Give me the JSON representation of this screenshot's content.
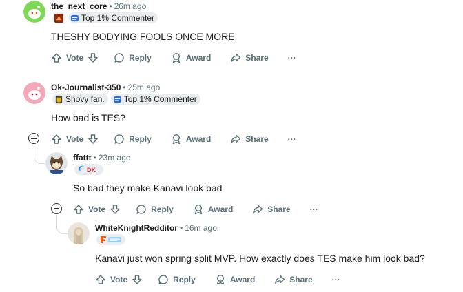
{
  "comments": [
    {
      "author": "the_next_core",
      "time": "26m ago",
      "flairs": [
        {
          "label": "",
          "icon": "team-logo-icon"
        },
        {
          "label": "Top 1% Commenter",
          "icon": "commenter-badge-icon"
        }
      ],
      "body": "THESHY BODYING FOOLS ONCE MORE",
      "actions": {
        "vote": "Vote",
        "reply": "Reply",
        "award": "Award",
        "share": "Share",
        "more": "···"
      }
    },
    {
      "author": "Ok-Journalist-350",
      "time": "25m ago",
      "flairs": [
        {
          "label": "Shovy fan.",
          "icon": "shovy-flair-icon"
        },
        {
          "label": "Top 1% Commenter",
          "icon": "commenter-badge-icon"
        }
      ],
      "body": "How bad is TES?",
      "actions": {
        "vote": "Vote",
        "reply": "Reply",
        "award": "Award",
        "share": "Share",
        "more": "···"
      }
    },
    {
      "author": "ffattt",
      "time": "23m ago",
      "flairs": [
        {
          "label": "",
          "icon": "team-logo-icon"
        }
      ],
      "body": "So bad they make Kanavi look bad",
      "actions": {
        "vote": "Vote",
        "reply": "Reply",
        "award": "Award",
        "share": "Share",
        "more": "···"
      }
    },
    {
      "author": "WhiteKnightRedditor",
      "time": "16m ago",
      "flairs": [
        {
          "label": "",
          "icon": "fnatic-logo-icon"
        }
      ],
      "body": "Kanavi just won spring split MVP. How exactly does TES make him look bad?",
      "actions": {
        "vote": "Vote",
        "reply": "Reply",
        "award": "Award",
        "share": "Share",
        "more": "···"
      }
    }
  ],
  "colors": {
    "meta": "#576f76",
    "flair_bg": "#eaedef",
    "thread_line": "#d7dadc",
    "avatar1": "#7ed957",
    "avatar2": "#f7a8b8"
  }
}
